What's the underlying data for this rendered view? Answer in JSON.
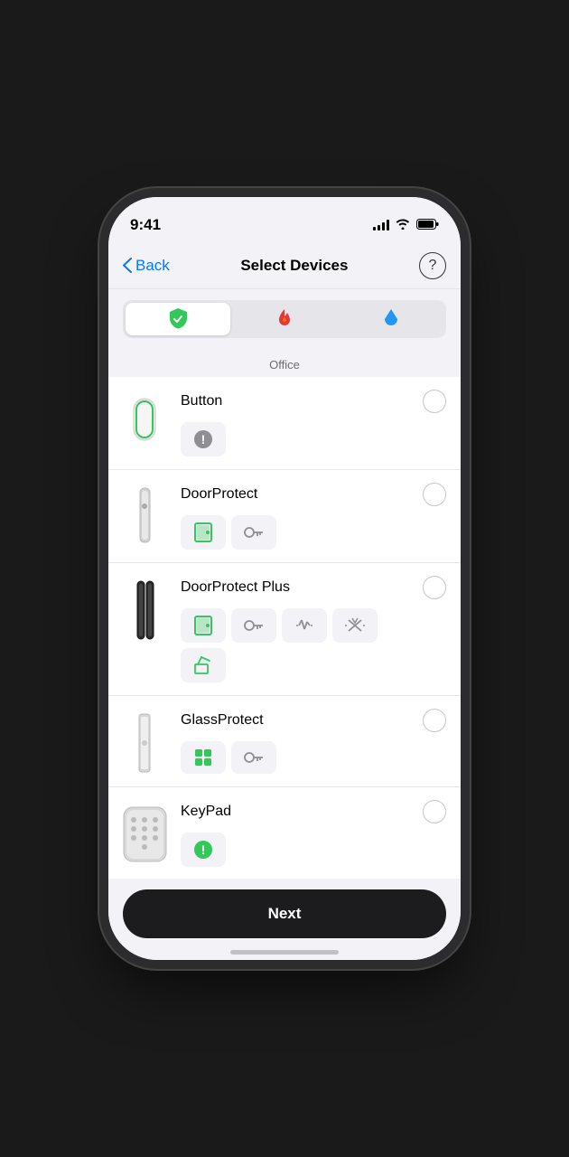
{
  "statusBar": {
    "time": "9:41",
    "signal": "full",
    "wifi": "on",
    "battery": "full"
  },
  "nav": {
    "back_label": "Back",
    "title": "Select Devices",
    "help_label": "?"
  },
  "tabs": [
    {
      "id": "security",
      "icon": "shield",
      "active": true
    },
    {
      "id": "fire",
      "icon": "flame",
      "active": false
    },
    {
      "id": "flood",
      "icon": "drop",
      "active": false
    }
  ],
  "section": {
    "label": "Office"
  },
  "devices": [
    {
      "id": "button",
      "name": "Button",
      "selected": false,
      "tags": [
        {
          "type": "warning-gray"
        }
      ]
    },
    {
      "id": "doorprotect",
      "name": "DoorProtect",
      "selected": false,
      "tags": [
        {
          "type": "door-green"
        },
        {
          "type": "key-gray"
        }
      ]
    },
    {
      "id": "doorprotect-plus",
      "name": "DoorProtect Plus",
      "selected": false,
      "tags": [
        {
          "type": "door-green"
        },
        {
          "type": "key-gray"
        },
        {
          "type": "vibration-gray"
        },
        {
          "type": "shock-gray"
        },
        {
          "type": "tilt-green"
        }
      ]
    },
    {
      "id": "glassprotect",
      "name": "GlassProtect",
      "selected": false,
      "tags": [
        {
          "type": "grid-green"
        },
        {
          "type": "key-gray"
        }
      ]
    },
    {
      "id": "keypad",
      "name": "KeyPad",
      "selected": false,
      "tags": [
        {
          "type": "warning-green"
        }
      ]
    }
  ],
  "bottom": {
    "next_label": "Next"
  }
}
